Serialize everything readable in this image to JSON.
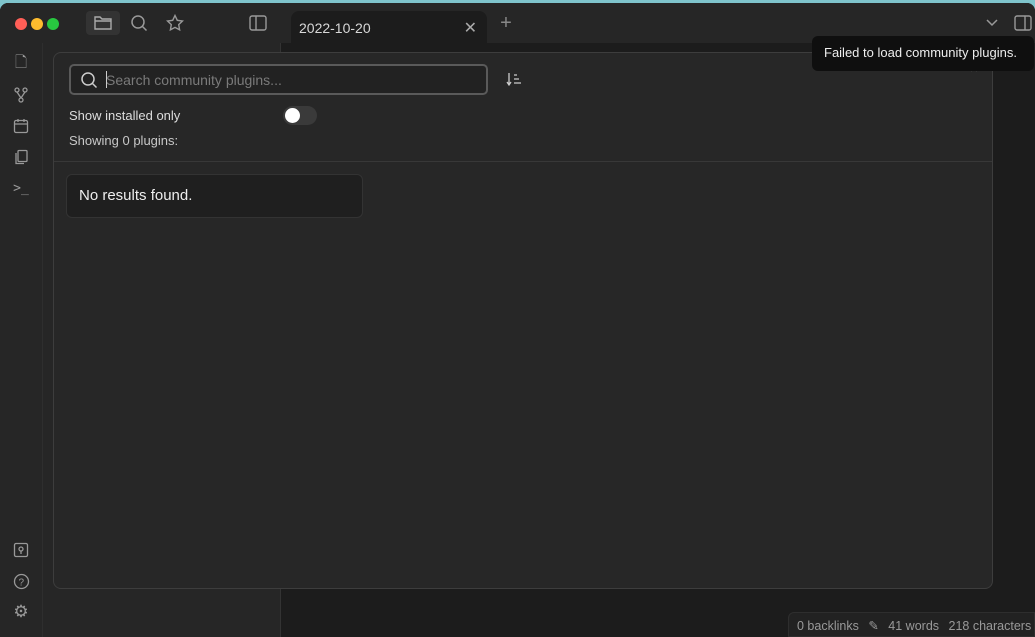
{
  "titlebar": {
    "tab_title": "2022-10-20"
  },
  "modal": {
    "search_placeholder": "Search community plugins...",
    "show_installed_label": "Show installed only",
    "show_installed_on": false,
    "showing_count": "Showing 0 plugins:",
    "no_results": "No results found."
  },
  "toast": {
    "message": "Failed to load community plugins."
  },
  "status": {
    "backlinks": "0 backlinks",
    "words": "41 words",
    "characters": "218 characters"
  },
  "colors": {
    "traffic_close": "#ff5f57",
    "traffic_min": "#febc2e",
    "traffic_max": "#28c840"
  }
}
